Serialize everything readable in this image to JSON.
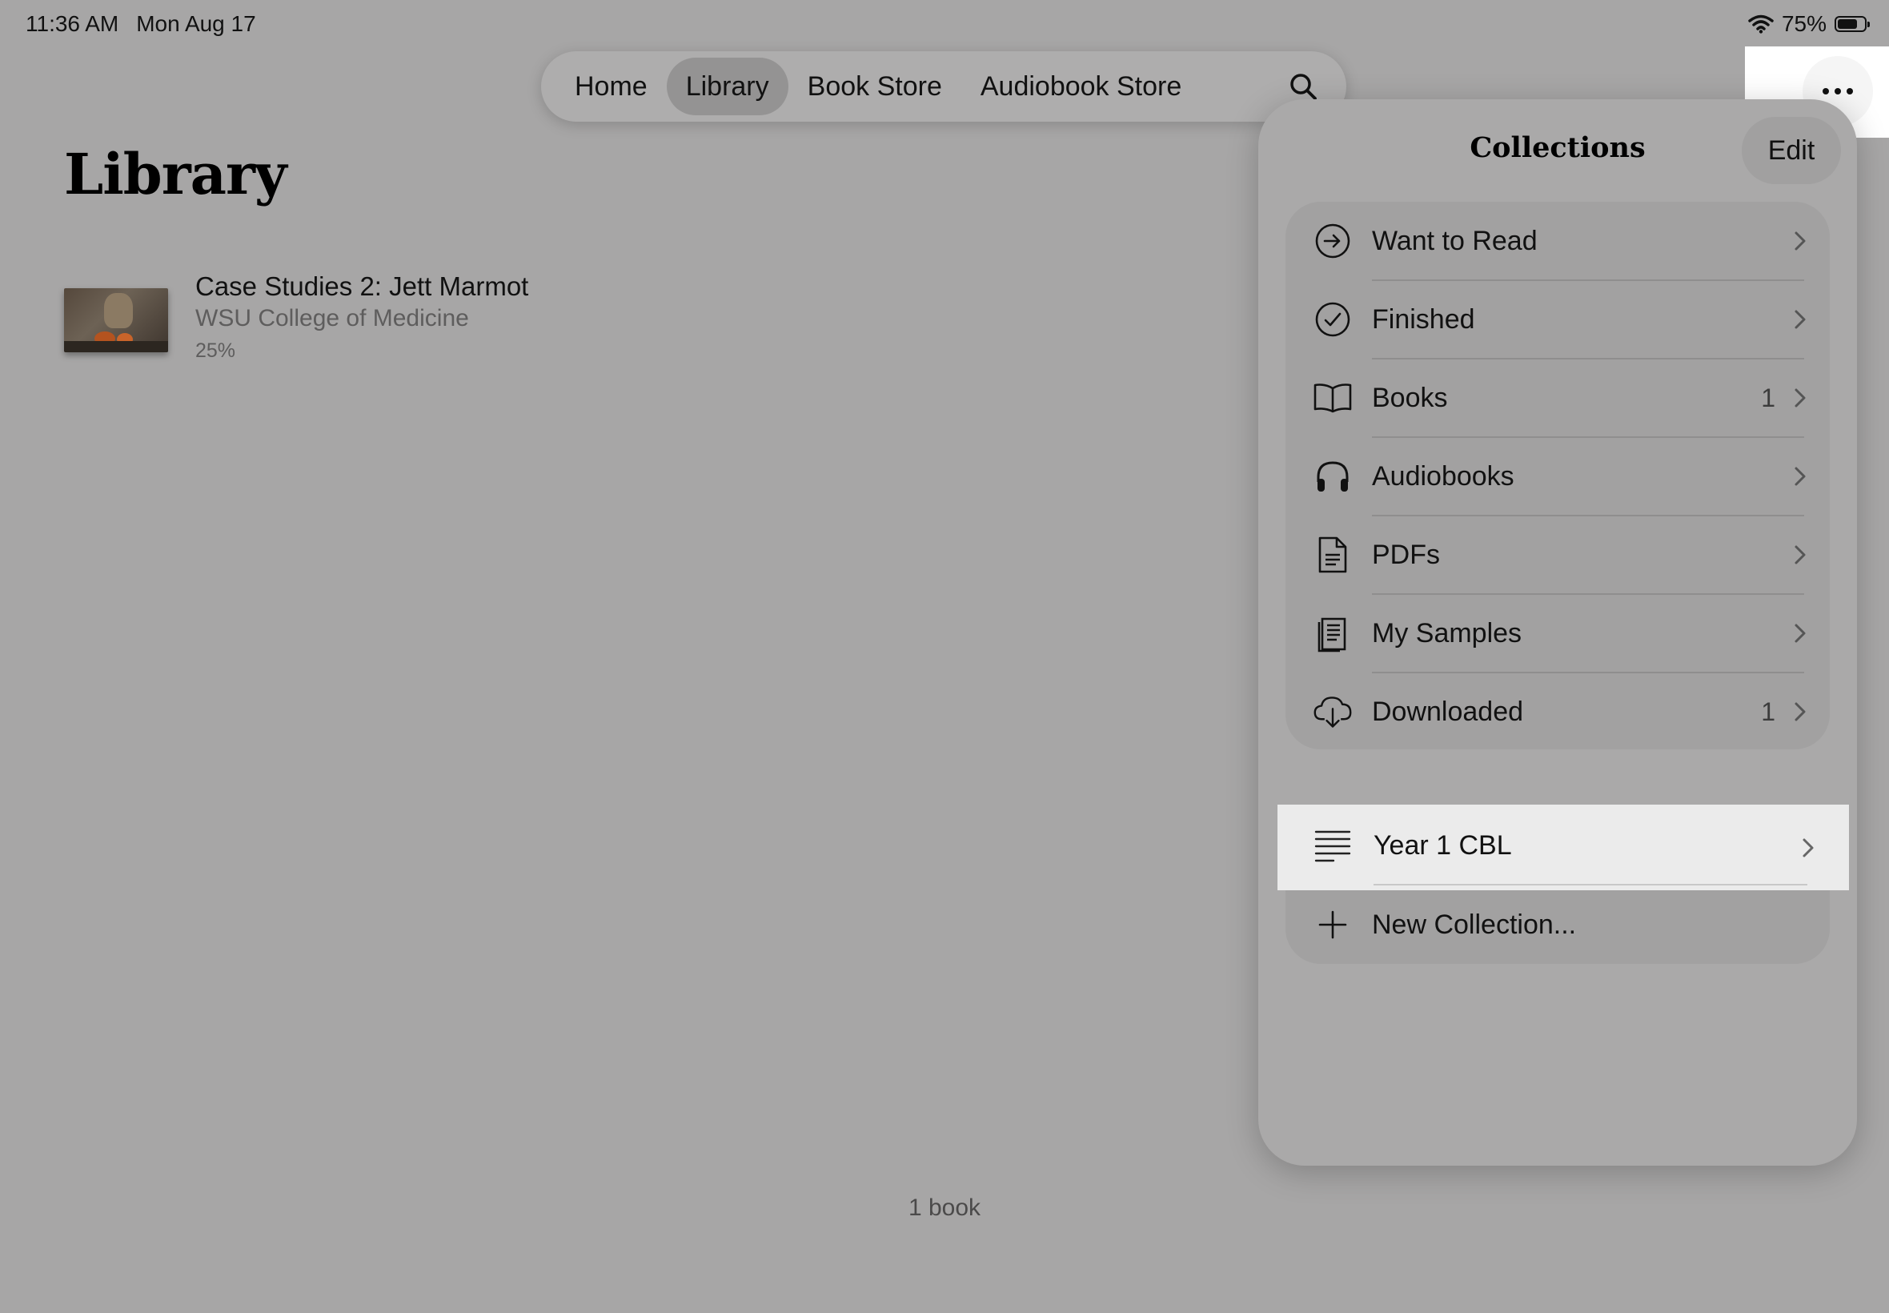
{
  "status_bar": {
    "time": "11:36 AM",
    "date": "Mon Aug 17",
    "battery_text": "75%",
    "battery_level": 0.75
  },
  "nav": {
    "tabs": [
      "Home",
      "Library",
      "Book Store",
      "Audiobook Store"
    ],
    "active_tab": "Library"
  },
  "page": {
    "title": "Library"
  },
  "book": {
    "title": "Case Studies 2: Jett Marmot",
    "author": "WSU College of Medicine",
    "progress": "25%"
  },
  "footer": {
    "count": "1 book"
  },
  "collections": {
    "title": "Collections",
    "edit_label": "Edit",
    "items": [
      {
        "label": "Want to Read",
        "icon": "arrow-circle-icon",
        "count": ""
      },
      {
        "label": "Finished",
        "icon": "checkmark-circle-icon",
        "count": ""
      },
      {
        "label": "Books",
        "icon": "book-icon",
        "count": "1"
      },
      {
        "label": "Audiobooks",
        "icon": "headphones-icon",
        "count": ""
      },
      {
        "label": "PDFs",
        "icon": "document-icon",
        "count": ""
      },
      {
        "label": "My Samples",
        "icon": "samples-icon",
        "count": ""
      },
      {
        "label": "Downloaded",
        "icon": "cloud-download-icon",
        "count": "1"
      }
    ],
    "custom": [
      {
        "label": "Year 1 CBL",
        "icon": "list-icon"
      }
    ],
    "new_collection_label": "New Collection..."
  },
  "colors": {
    "background": "#a7a6a6",
    "panel": "#aaa9a9",
    "highlight": "#ebebeb"
  }
}
